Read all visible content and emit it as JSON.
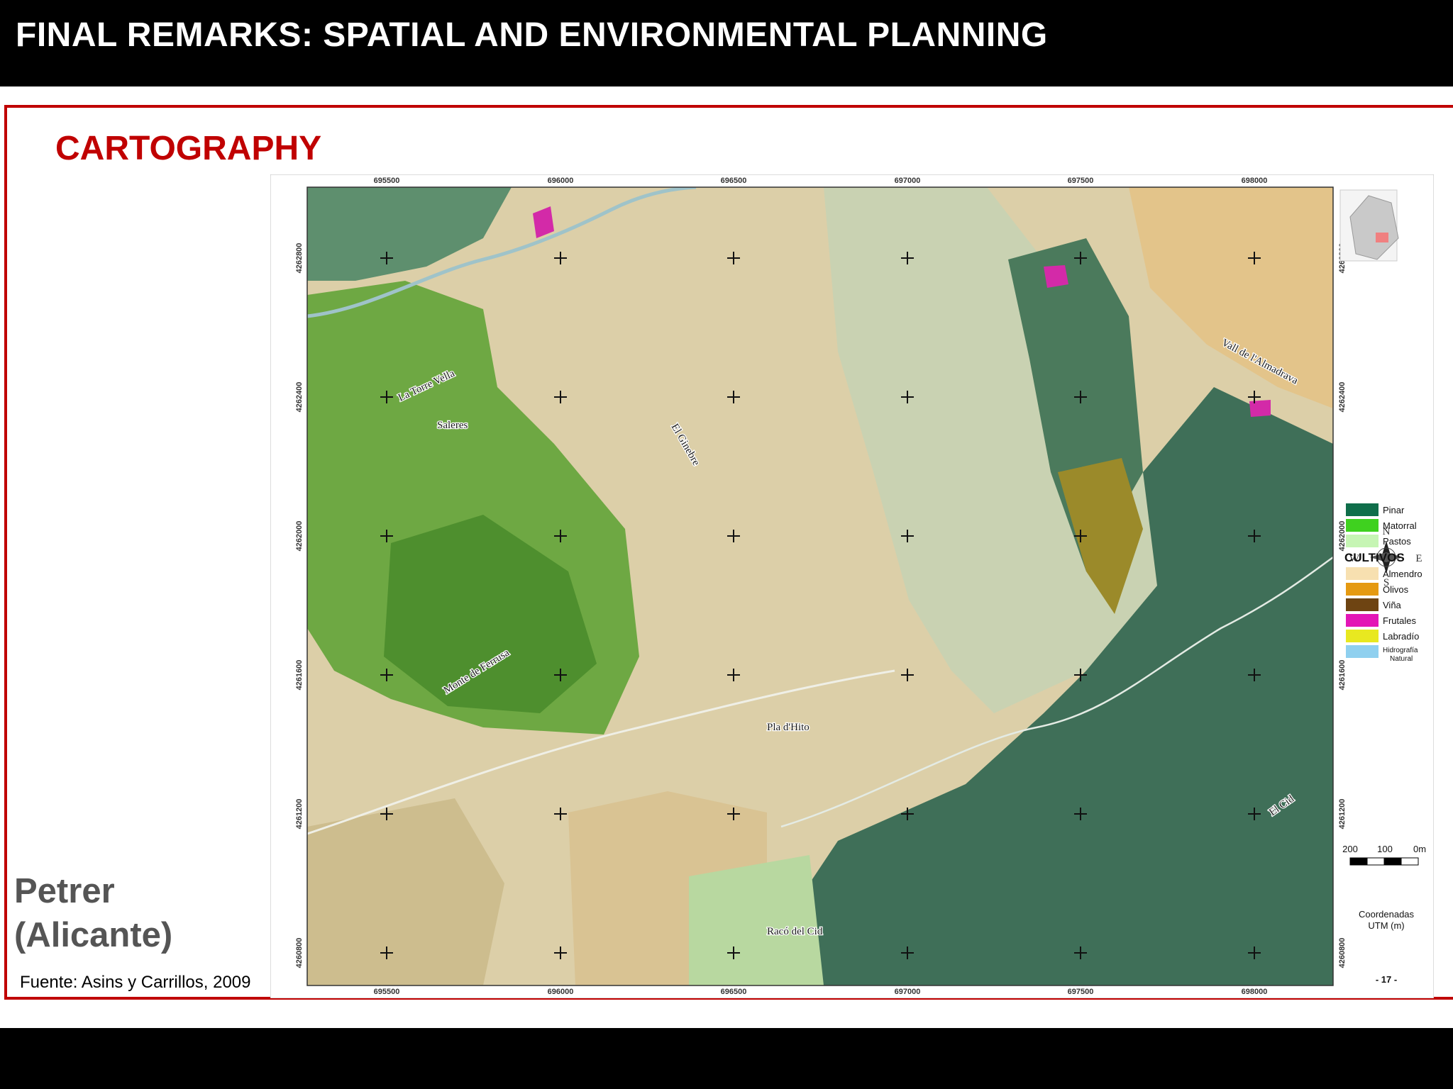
{
  "header": {
    "title": "FINAL REMARKS: SPATIAL AND ENVIRONMENTAL PLANNING"
  },
  "section": {
    "title": "CARTOGRAPHY"
  },
  "location": {
    "line1": "Petrer",
    "line2": "(Alicante)"
  },
  "source": "Fuente: Asins y Carrillos, 2009",
  "map": {
    "x_coords": [
      "695500",
      "696000",
      "696500",
      "697000",
      "697500",
      "698000"
    ],
    "y_coords": [
      "4262800",
      "4262400",
      "4262000",
      "4261600",
      "4261200",
      "4260800"
    ],
    "place_names": {
      "vall": "Vall de l'Almadrava",
      "ginebre": "El Ginebre",
      "saleres": "Saleres",
      "ferrusa": "Monte de Ferrusa",
      "pla": "Pla d'Hito",
      "cid": "El Cid",
      "raco": "Racó del Cid",
      "vella": "La Torre Vella"
    },
    "compass": {
      "n": "N",
      "s": "S",
      "e": "E",
      "w": "W"
    },
    "legend": {
      "items": [
        {
          "label": "Pinar",
          "color": "#0f6e4a"
        },
        {
          "label": "Matorral",
          "color": "#3fd11f"
        },
        {
          "label": "Pastos",
          "color": "#c6f5b4"
        }
      ],
      "cultivos_header": "CULTIVOS",
      "cultivos": [
        {
          "label": "Almendro",
          "color": "#f7e0b0"
        },
        {
          "label": "Olivos",
          "color": "#e59a12"
        },
        {
          "label": "Viña",
          "color": "#6e4412"
        },
        {
          "label": "Frutales",
          "color": "#e316b6"
        },
        {
          "label": "Labradío",
          "color": "#e8e820"
        }
      ],
      "hidro_line1": "Hidrografía",
      "hidro_line2": "Natural",
      "hidro_color": "#8fd0ef"
    },
    "scale": {
      "t200": "200",
      "t100": "100",
      "t0": "0m"
    },
    "coords_note_line1": "Coordenadas",
    "coords_note_line2": "UTM (m)",
    "page_number": "- 17 -"
  }
}
